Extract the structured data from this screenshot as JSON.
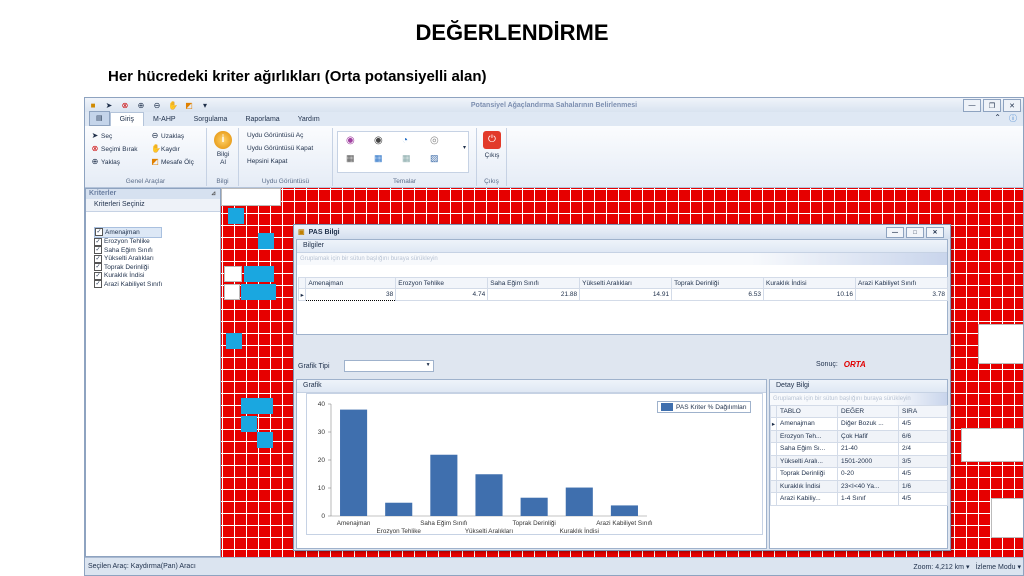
{
  "slide": {
    "title": "DEĞERLENDİRME",
    "subtitle": "Her hücredeki kriter ağırlıkları (Orta potansiyelli alan)"
  },
  "app": {
    "window_title": "Potansiyel Ağaçlandırma Sahalarının Belirlenmesi",
    "tabs": [
      "Giriş",
      "M-AHP",
      "Sorgulama",
      "Raporlama",
      "Yardım"
    ],
    "active_tab": "Giriş",
    "ribbon": {
      "genel": {
        "label": "Genel Araçlar",
        "items": [
          "Seç",
          "Uzaklaş",
          "Seçimi Bırak",
          "Kaydır",
          "Yaklaş",
          "Mesafe Ölç"
        ]
      },
      "bilgi": {
        "label": "Bilgi",
        "button": "Bilgi Al"
      },
      "uydu": {
        "label": "Uydu Görüntüsü",
        "items": [
          "Uydu Görüntüsü Aç",
          "Uydu Görüntüsü Kapat",
          "Hepsini Kapat"
        ]
      },
      "temalar": {
        "label": "Temalar"
      },
      "cikis": {
        "label": "Çıkış",
        "button": "Çıkış"
      }
    },
    "sidebar": {
      "header": "Kriterler",
      "subheader": "Kriterleri Seçiniz",
      "items": [
        "Amenajman",
        "Erozyon Tehlike",
        "Saha Eğim Sınıfı",
        "Yükselti Aralıkları",
        "Toprak Derinliği",
        "Kuraklık İndisi",
        "Arazi Kabiliyet Sınıfı"
      ]
    },
    "status": {
      "left": "Seçilen Araç: Kaydırma(Pan) Aracı",
      "zoom": "Zoom: 4,212 km",
      "mode": "İzleme Modu"
    }
  },
  "dialog": {
    "title": "PAS Bilgi",
    "bilgiler": {
      "header": "Bilgiler",
      "group_hint": "Gruplamak için bir sütun başlığını buraya sürükleyin",
      "columns": [
        "Amenajman",
        "Erozyon Tehlike",
        "Saha Eğim Sınıfı",
        "Yükselti Aralıkları",
        "Toprak Derinliği",
        "Kuraklık İndisi",
        "Arazi Kabiliyet Sınıfı"
      ],
      "row": [
        "38",
        "4.74",
        "21.88",
        "14.91",
        "6.53",
        "10.16",
        "3.78"
      ]
    },
    "grafik_tipi_label": "Grafik Tipi",
    "sonuc_label": "Sonuç:",
    "sonuc_value": "ORTA",
    "grafik_header": "Grafik",
    "detay": {
      "header": "Detay Bilgi",
      "group_hint": "Gruplamak için bir sütun başlığını buraya sürükleyin",
      "columns": [
        "TABLO",
        "DEĞER",
        "SIRA"
      ],
      "rows": [
        [
          "Amenajman",
          "Diğer Bozuk ...",
          "4/5"
        ],
        [
          "Erozyon Teh...",
          "Çok Hafif",
          "6/6"
        ],
        [
          "Saha Eğim Sı...",
          "21-40",
          "2/4"
        ],
        [
          "Yükselti Aralı...",
          "1501-2000",
          "3/5"
        ],
        [
          "Toprak Derinliği",
          "0-20",
          "4/5"
        ],
        [
          "Kuraklık İndisi",
          "23<I<40 Ya...",
          "1/6"
        ],
        [
          "Arazi Kabiliy...",
          "1-4 Sınıf",
          "4/5"
        ]
      ]
    }
  },
  "chart_data": {
    "type": "bar",
    "categories": [
      "Amenajman",
      "Erozyon Tehlike",
      "Saha Eğim Sınıfı",
      "Yükselti Aralıkları",
      "Toprak Derinliği",
      "Kuraklık İndisi",
      "Arazi Kabiliyet Sınıfı"
    ],
    "series": [
      {
        "name": "PAS Kriter % Dağılımları",
        "values": [
          38,
          4.74,
          21.88,
          14.91,
          6.53,
          10.16,
          3.78
        ]
      }
    ],
    "yticks": [
      "0",
      "10",
      "20",
      "30",
      "40"
    ],
    "ylim": [
      0,
      40
    ],
    "color": "#3f6fae",
    "grid": false,
    "legend": "top-right"
  }
}
